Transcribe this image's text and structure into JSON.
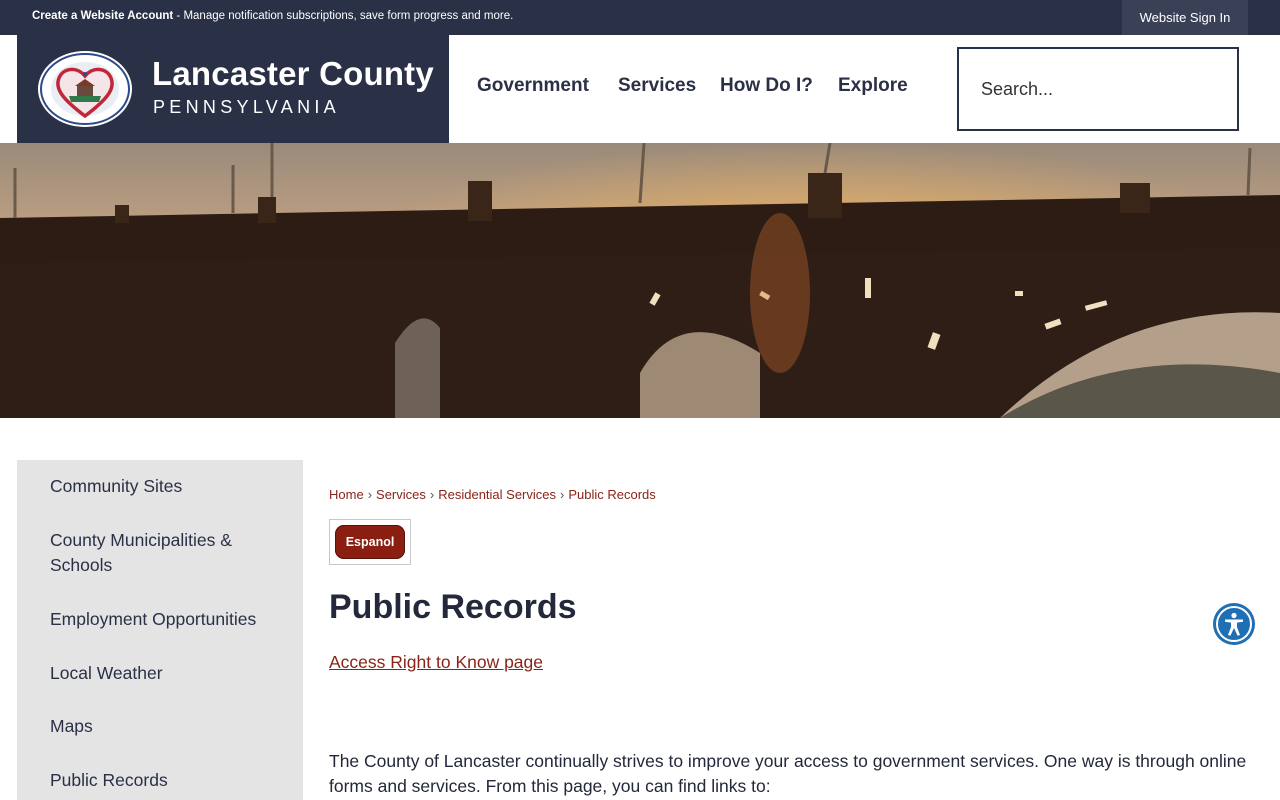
{
  "topbar": {
    "create_account_bold": "Create a Website Account",
    "create_account_text": " - Manage notification subscriptions, save form progress and more.",
    "sign_in_label": "Website Sign In"
  },
  "header": {
    "county_name": "Lancaster County",
    "state_name": "PENNSYLVANIA",
    "nav": [
      "Government",
      "Services",
      "How Do I?",
      "Explore"
    ],
    "search_placeholder": "Search..."
  },
  "sidebar": {
    "items": [
      "Community Sites",
      "County Municipalities & Schools",
      "Employment Opportunities",
      "Local Weather",
      "Maps",
      "Public Records"
    ]
  },
  "breadcrumb": [
    "Home",
    "Services",
    "Residential Services",
    "Public Records"
  ],
  "content": {
    "espanol_label": "Espanol",
    "title": "Public Records",
    "rtk_link": "Access Right to Know page",
    "body": "The County of Lancaster continually strives to improve your access to government services. One way is through online forms and services. From this page, you can find links to:"
  },
  "colors": {
    "navy": "#2a3046",
    "link_red": "#8a2418",
    "sidebar_bg": "#e4e4e4",
    "accessibility_blue": "#1f6fb5"
  }
}
